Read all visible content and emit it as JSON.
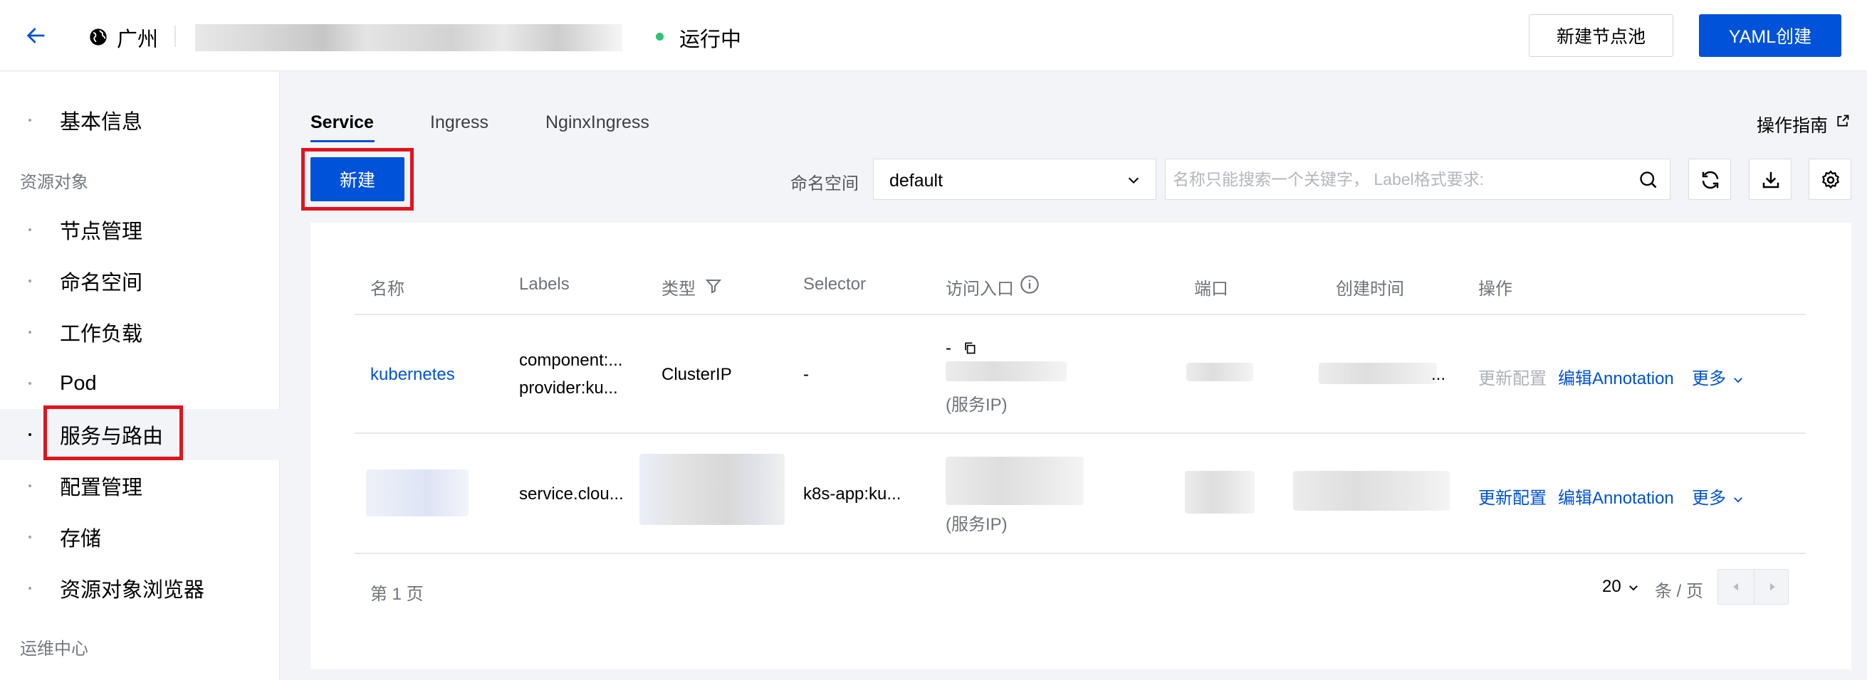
{
  "header": {
    "region": "广州",
    "status": "运行中",
    "btn_new_pool": "新建节点池",
    "btn_yaml": "YAML创建"
  },
  "sidebar": {
    "items_top": [
      {
        "label": "基本信息"
      }
    ],
    "group1": "资源对象",
    "items": [
      {
        "label": "节点管理"
      },
      {
        "label": "命名空间"
      },
      {
        "label": "工作负载"
      },
      {
        "label": "Pod"
      },
      {
        "label": "服务与路由"
      },
      {
        "label": "配置管理"
      },
      {
        "label": "存储"
      },
      {
        "label": "资源对象浏览器"
      }
    ],
    "group2": "运维中心"
  },
  "tabs": [
    {
      "label": "Service"
    },
    {
      "label": "Ingress"
    },
    {
      "label": "NginxIngress"
    }
  ],
  "guide": "操作指南",
  "toolbar": {
    "new": "新建",
    "namespace_label": "命名空间",
    "namespace_value": "default",
    "search_placeholder": "名称只能搜索一个关键字， Label格式要求:"
  },
  "table": {
    "headers": [
      "名称",
      "Labels",
      "类型",
      "Selector",
      "访问入口",
      "端口",
      "创建时间",
      "操作"
    ],
    "rows": [
      {
        "name": "kubernetes",
        "labels": [
          "component:...",
          "provider:ku..."
        ],
        "type": "ClusterIP",
        "selector": "-",
        "access_prefix": "-",
        "access_note": "(服务IP)",
        "created_suffix": "...",
        "actions": [
          "更新配置",
          "编辑Annotation",
          "更多"
        ]
      },
      {
        "labels": [
          "service.clou..."
        ],
        "selector": "k8s-app:ku...",
        "access_note": "(服务IP)",
        "actions": [
          "更新配置",
          "编辑Annotation",
          "更多"
        ]
      }
    ]
  },
  "pager": {
    "page": "第 1 页",
    "size": "20",
    "unit": "条 / 页"
  },
  "colors": {
    "primary": "#0052d9",
    "status_green": "#2ec271",
    "highlight_red": "#e0141e"
  }
}
